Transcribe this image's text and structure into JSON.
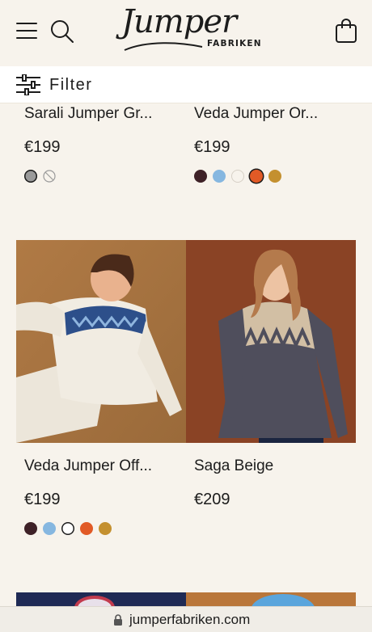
{
  "header": {
    "logo_script": "Jumper",
    "logo_sub": "FABRIKEN"
  },
  "filter": {
    "label": "Filter"
  },
  "products": [
    {
      "title": "Sarali Jumper Gr...",
      "price": "€199",
      "swatches": [
        "#9a9a9a",
        "disabled"
      ],
      "selected": 0
    },
    {
      "title": "Veda Jumper Or...",
      "price": "€199",
      "swatches": [
        "#3e2127",
        "#86b7e0",
        "#f7f3ec",
        "#e15a26",
        "#c4902f"
      ],
      "selected": 3
    },
    {
      "title": "Veda Jumper Off...",
      "price": "€199",
      "swatches": [
        "#3e2127",
        "#86b7e0",
        "#ffffff",
        "#e15a26",
        "#c4902f"
      ],
      "selected": 2
    },
    {
      "title": "Saga Beige",
      "price": "€209",
      "swatches": [],
      "selected": -1
    }
  ],
  "browser": {
    "url": "jumperfabriken.com"
  },
  "colors": {
    "background": "#f7f3ec",
    "text": "#1c1c1c"
  }
}
